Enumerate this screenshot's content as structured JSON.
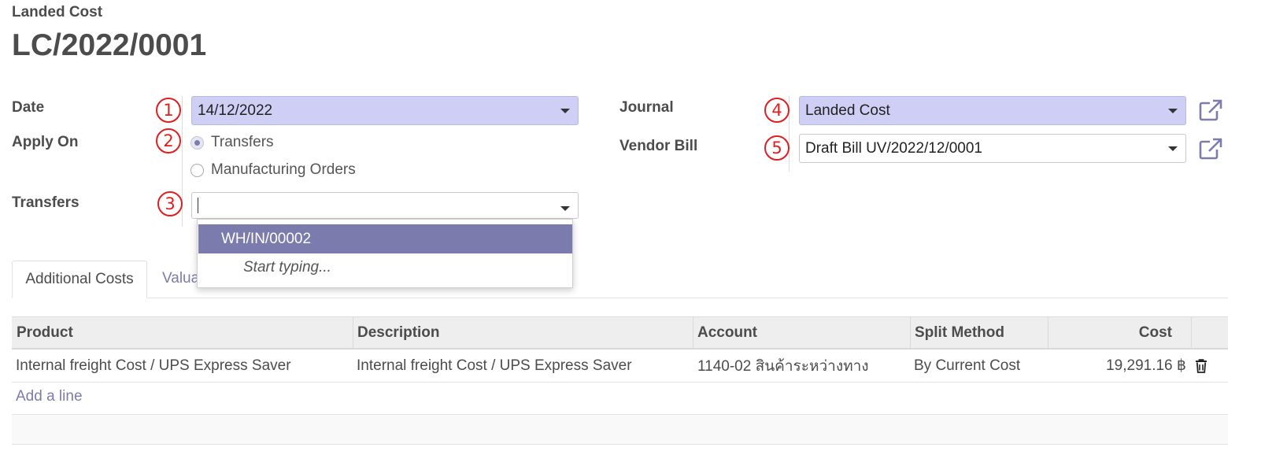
{
  "header": {
    "model_label": "Landed Cost",
    "record_name": "LC/2022/0001"
  },
  "form": {
    "date": {
      "label": "Date",
      "value": "14/12/2022",
      "callout": "1"
    },
    "apply_on": {
      "label": "Apply On",
      "callout": "2",
      "options": [
        "Transfers",
        "Manufacturing Orders"
      ],
      "selected": "Transfers"
    },
    "transfers": {
      "label": "Transfers",
      "value": "",
      "callout": "3"
    },
    "journal": {
      "label": "Journal",
      "value": "Landed Cost",
      "callout": "4"
    },
    "vendor_bill": {
      "label": "Vendor Bill",
      "value": "Draft Bill UV/2022/12/0001",
      "callout": "5"
    }
  },
  "dropdown": {
    "items": [
      "WH/IN/00002"
    ],
    "hint": "Start typing..."
  },
  "tabs": [
    "Additional Costs",
    "Valua"
  ],
  "table": {
    "columns": [
      "Product",
      "Description",
      "Account",
      "Split Method",
      "Cost"
    ],
    "rows": [
      {
        "product": "Internal freight Cost / UPS Express Saver",
        "description": "Internal freight Cost / UPS Express Saver",
        "account": "1140-02 สินค้าระหว่างทาง",
        "split_method": "By Current Cost",
        "cost": "19,291.16 ฿"
      }
    ],
    "add_line_label": "Add a line"
  },
  "colors": {
    "accent": "#7c7bad",
    "field_highlight": "#cfcff6",
    "callout": "#e11d1d"
  },
  "icons": {
    "external_link": "external-link-icon",
    "delete": "trash-icon",
    "dropdown": "caret-down-icon"
  }
}
